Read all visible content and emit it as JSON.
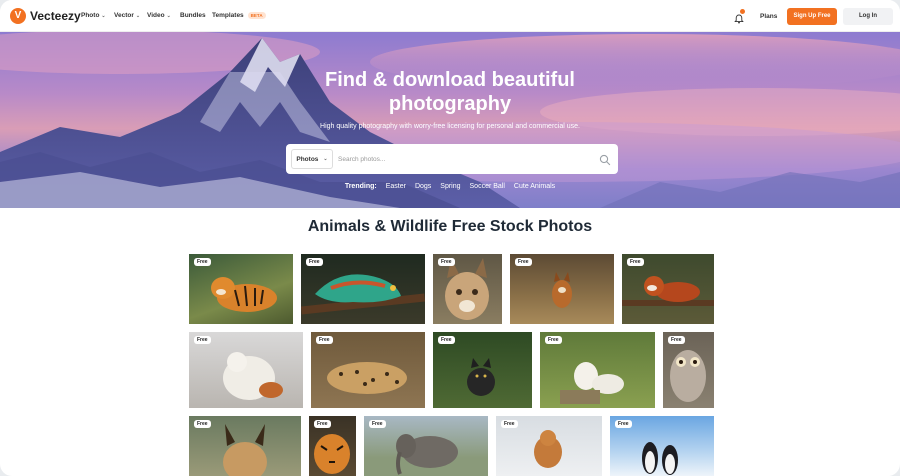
{
  "nav": {
    "brand": "Vecteezy",
    "items": [
      {
        "label": "Photo",
        "dropdown": true
      },
      {
        "label": "Vector",
        "dropdown": true
      },
      {
        "label": "Video",
        "dropdown": true
      },
      {
        "label": "Bundles",
        "dropdown": false
      },
      {
        "label": "Templates",
        "dropdown": false,
        "badge": "BETA"
      }
    ],
    "plans": "Plans",
    "signup": "Sign Up Free",
    "login": "Log In"
  },
  "hero": {
    "title_line1": "Find & download beautiful",
    "title_line2": "photography",
    "subtitle": "High quality photography with worry-free licensing for personal and commercial use.",
    "search": {
      "type": "Photos",
      "placeholder": "Search photos..."
    },
    "trending_label": "Trending:",
    "trending": [
      "Easter",
      "Dogs",
      "Spring",
      "Soccer Ball",
      "Cute Animals"
    ]
  },
  "section": {
    "title": "Animals & Wildlife Free Stock Photos",
    "free_label": "Free",
    "photos": [
      {
        "subject": "tiger lying"
      },
      {
        "subject": "chameleon"
      },
      {
        "subject": "lynx"
      },
      {
        "subject": "fox in grass"
      },
      {
        "subject": "red panda"
      },
      {
        "subject": "polar bear cub plush"
      },
      {
        "subject": "leopard resting"
      },
      {
        "subject": "black fox cub"
      },
      {
        "subject": "arctic foxes"
      },
      {
        "subject": "owl"
      },
      {
        "subject": "caracal"
      },
      {
        "subject": "tiger face"
      },
      {
        "subject": "elephant"
      },
      {
        "subject": "dog in snow"
      },
      {
        "subject": "penguins"
      }
    ]
  },
  "colors": {
    "accent": "#f27121",
    "title": "#1f2a36"
  }
}
